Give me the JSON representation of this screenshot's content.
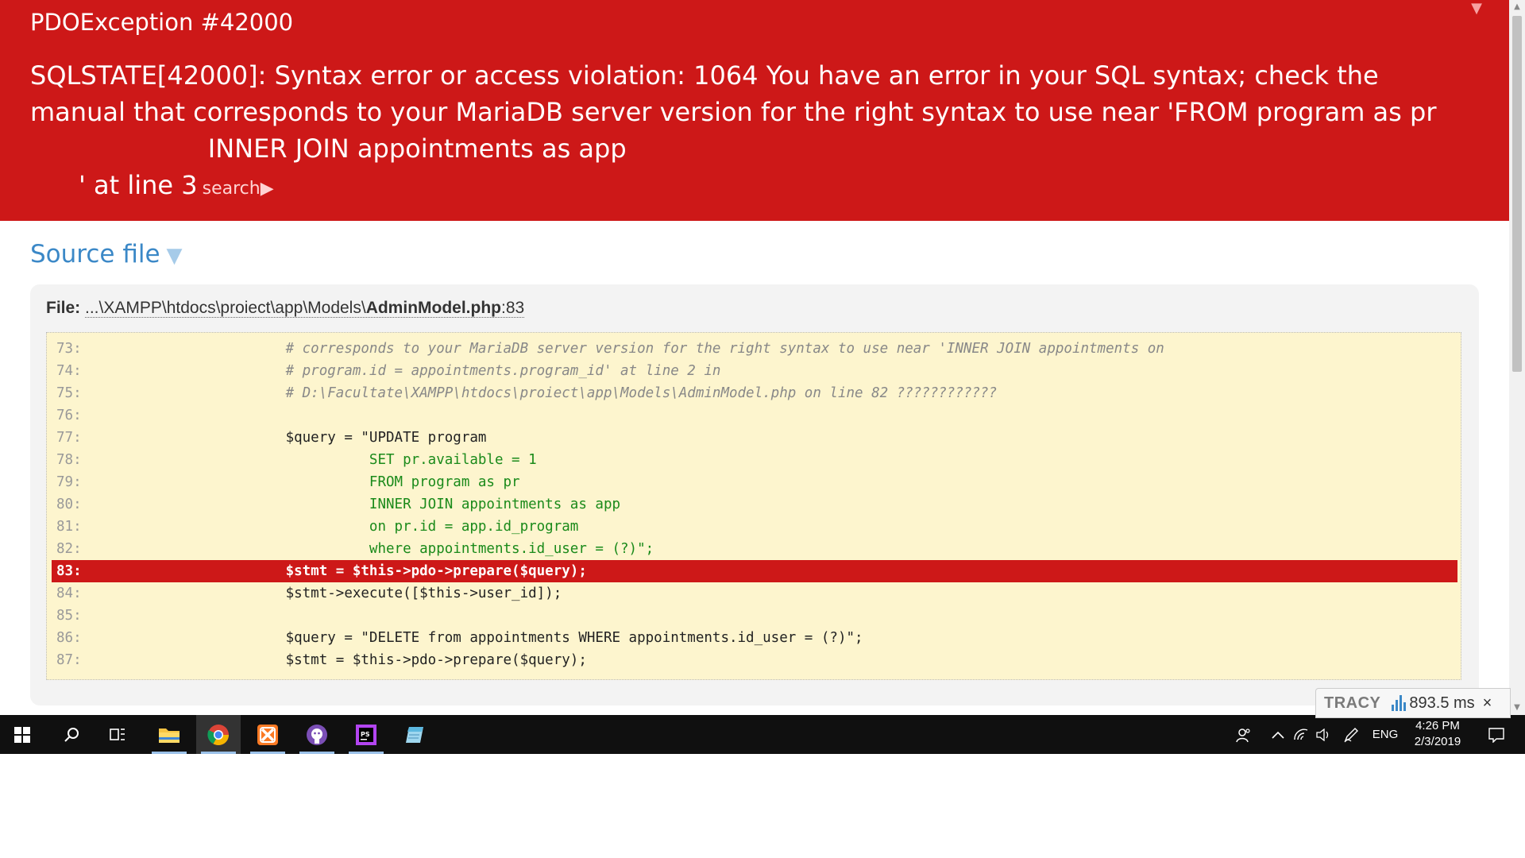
{
  "error": {
    "title": "PDOException #42000",
    "message_lines": [
      "SQLSTATE[42000]: Syntax error or access violation: 1064 You have an error in your SQL syntax; check the",
      "manual that corresponds to your MariaDB server version for the right syntax to use near 'FROM program as pr",
      "                      INNER JOIN appointments as app",
      "      ' at line 3"
    ],
    "search_label": "search▶",
    "collapse_glyph": "▼"
  },
  "source": {
    "section_title": "Source file",
    "toggle_glyph": "▼",
    "file_label": "File:",
    "file_path": "...\\XAMPP\\htdocs\\proiect\\app\\Models\\",
    "file_name": "AdminModel.php",
    "file_line": ":83",
    "lines": [
      {
        "n": "73:",
        "t": "                # corresponds to your MariaDB server version for the right syntax to use near 'INNER JOIN appointments on",
        "kind": "comment"
      },
      {
        "n": "74:",
        "t": "                # program.id = appointments.program_id' at line 2 in",
        "kind": "comment"
      },
      {
        "n": "75:",
        "t": "                # D:\\Facultate\\XAMPP\\htdocs\\proiect\\app\\Models\\AdminModel.php on line 82 ????????????",
        "kind": "comment"
      },
      {
        "n": "76:",
        "t": "",
        "kind": "code"
      },
      {
        "n": "77:",
        "t": "                $query = \"UPDATE program",
        "kind": "code"
      },
      {
        "n": "78:",
        "t": "                          SET pr.available = 1",
        "kind": "str"
      },
      {
        "n": "79:",
        "t": "                          FROM program as pr",
        "kind": "str"
      },
      {
        "n": "80:",
        "t": "                          INNER JOIN appointments as app",
        "kind": "str"
      },
      {
        "n": "81:",
        "t": "                          on pr.id = app.id_program",
        "kind": "str"
      },
      {
        "n": "82:",
        "t": "                          where appointments.id_user = (?)\";",
        "kind": "str"
      },
      {
        "n": "83:",
        "t": "                $stmt = $this->pdo->prepare($query);",
        "kind": "highlight"
      },
      {
        "n": "84:",
        "t": "                $stmt->execute([$this->user_id]);",
        "kind": "code"
      },
      {
        "n": "85:",
        "t": "",
        "kind": "code"
      },
      {
        "n": "86:",
        "t": "                $query = \"DELETE from appointments WHERE appointments.id_user = (?)\";",
        "kind": "code"
      },
      {
        "n": "87:",
        "t": "                $stmt = $this->pdo->prepare($query);",
        "kind": "code"
      }
    ]
  },
  "tracy": {
    "logo": "TRACY",
    "time": "893.5 ms",
    "close": "×"
  },
  "taskbar": {
    "apps": [
      {
        "name": "file-explorer",
        "active": false
      },
      {
        "name": "chrome",
        "active": true
      },
      {
        "name": "xampp",
        "active": false
      },
      {
        "name": "github-desktop",
        "active": false
      },
      {
        "name": "phpstorm",
        "active": false
      },
      {
        "name": "notepad",
        "active": false
      }
    ],
    "language": "ENG",
    "time": "4:26 PM",
    "date": "2/3/2019"
  },
  "colors": {
    "error_red": "#cd1818",
    "link_blue": "#3b88c7",
    "code_bg": "#fdf5ce"
  }
}
